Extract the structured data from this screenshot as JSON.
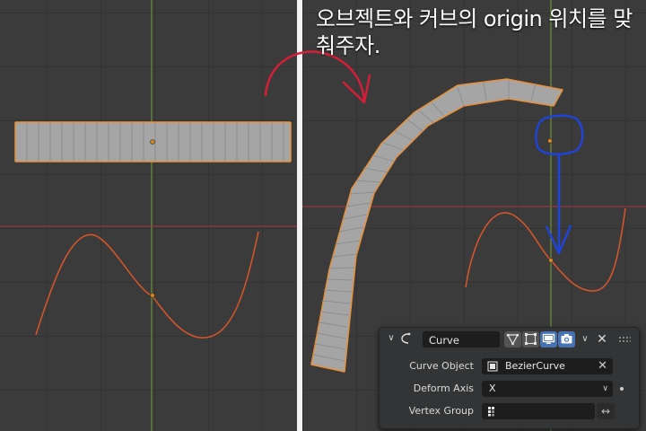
{
  "annotation": {
    "text": "오브젝트와 커브의 origin 위치를 맞춰주자."
  },
  "viewport_left": {
    "mesh_object": "curved-mesh-strip",
    "curve_object": "bezier-curve"
  },
  "viewport_right": {
    "mesh_object": "deformed-mesh-strip",
    "curve_object": "bezier-curve"
  },
  "modifier_panel": {
    "name": "Curve",
    "header_icons": [
      "curve-modifier-icon",
      "edit-mode-icon",
      "on-cage-icon",
      "realtime-display-icon",
      "render-camera-icon"
    ],
    "curve_object_label": "Curve Object",
    "curve_object_value": "BezierCurve",
    "deform_axis_label": "Deform Axis",
    "deform_axis_value": "X",
    "vertex_group_label": "Vertex Group",
    "vertex_group_value": ""
  },
  "colors": {
    "selection_orange": "#e8913a",
    "curve_orange": "#d9572b",
    "annotation_red": "#d41f3a",
    "annotation_blue": "#1f44d6",
    "active_button_blue": "#4772b3"
  }
}
